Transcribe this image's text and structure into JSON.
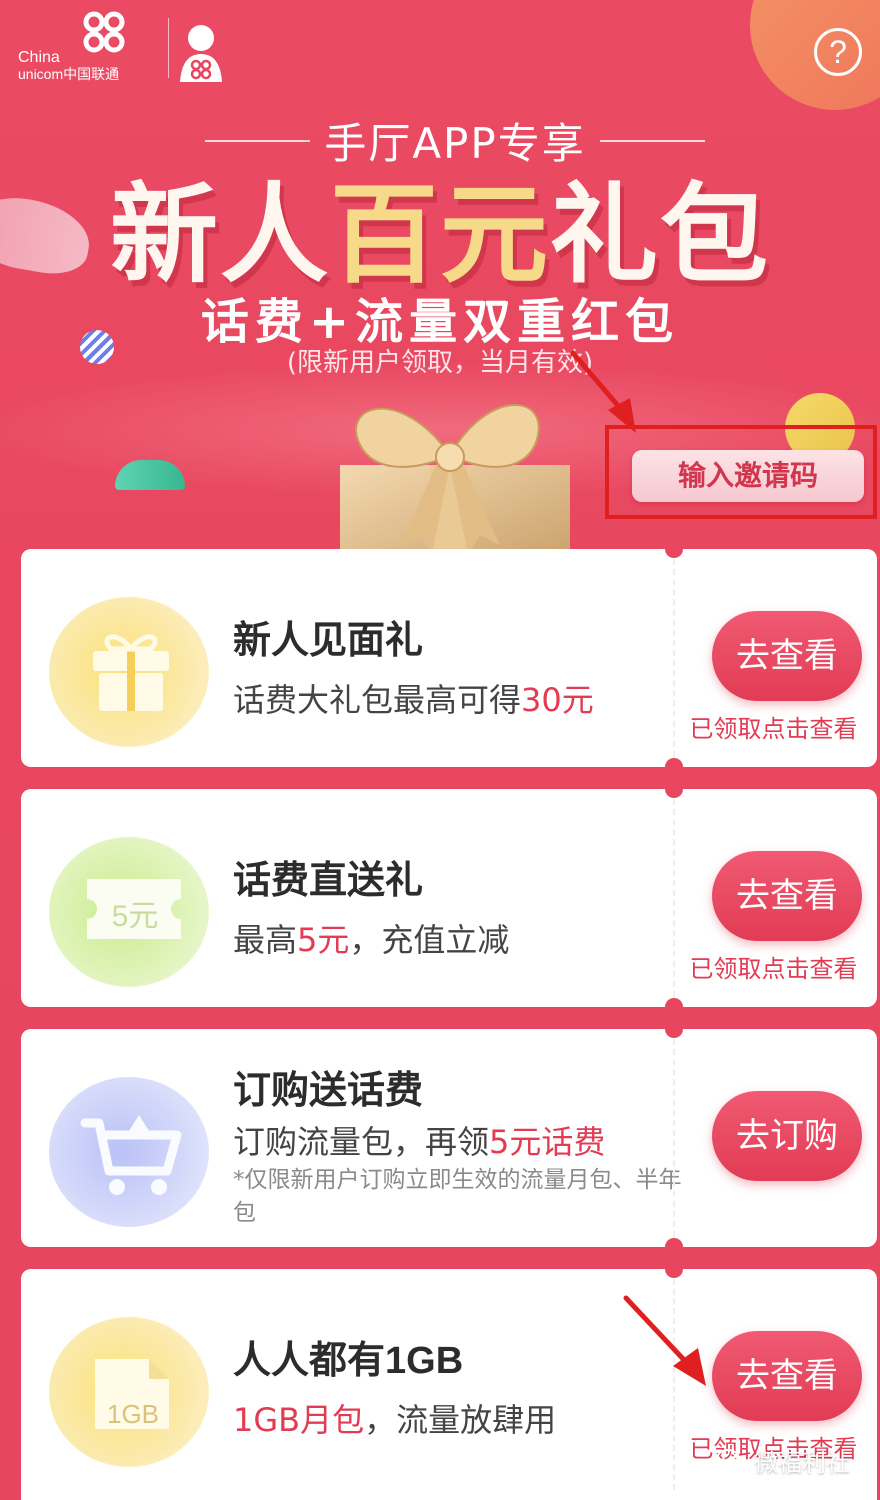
{
  "header": {
    "logo_en_line1": "China",
    "logo_en_line2": "unicom中国联通",
    "help_symbol": "?",
    "subtitle": "手厅APP专享",
    "title_part1": "新人",
    "title_part2": "百元",
    "title_part3": "礼包",
    "tagline": "话费+流量双重红包",
    "note": "(限新用户领取，当月有效)",
    "invite_button": "输入邀请码"
  },
  "cards": [
    {
      "title": "新人见面礼",
      "desc_prefix": "话费大礼包最高可得",
      "desc_highlight": "30元",
      "desc_suffix": "",
      "button": "去查看",
      "status": "已领取点击查看",
      "icon": "gift-icon",
      "icon_color": "#f6cf5a"
    },
    {
      "title": "话费直送礼",
      "desc_prefix": "最高",
      "desc_highlight": "5元",
      "desc_suffix": "，充值立减",
      "icon_text": "5元",
      "button": "去查看",
      "status": "已领取点击查看",
      "icon": "coupon-icon",
      "icon_color": "#b8e27a"
    },
    {
      "title": "订购送话费",
      "desc_prefix": "订购流量包，再领",
      "desc_highlight": "5元话费",
      "desc_suffix": "",
      "note": "*仅限新用户订购立即生效的流量月包、半年包",
      "button": "去订购",
      "icon": "cart-icon",
      "icon_color": "#a9b3f5"
    },
    {
      "title": "人人都有1GB",
      "desc_prefix": "",
      "desc_highlight": "1GB月包",
      "desc_suffix": "，流量放肆用",
      "icon_text": "1GB",
      "button": "去查看",
      "status": "已领取点击查看",
      "icon": "folder-icon",
      "icon_color": "#f6cf5a"
    }
  ],
  "watermark": "微福利社",
  "colors": {
    "background": "#e8465e",
    "accent": "#e23b52",
    "gold": "#f7d98a"
  }
}
